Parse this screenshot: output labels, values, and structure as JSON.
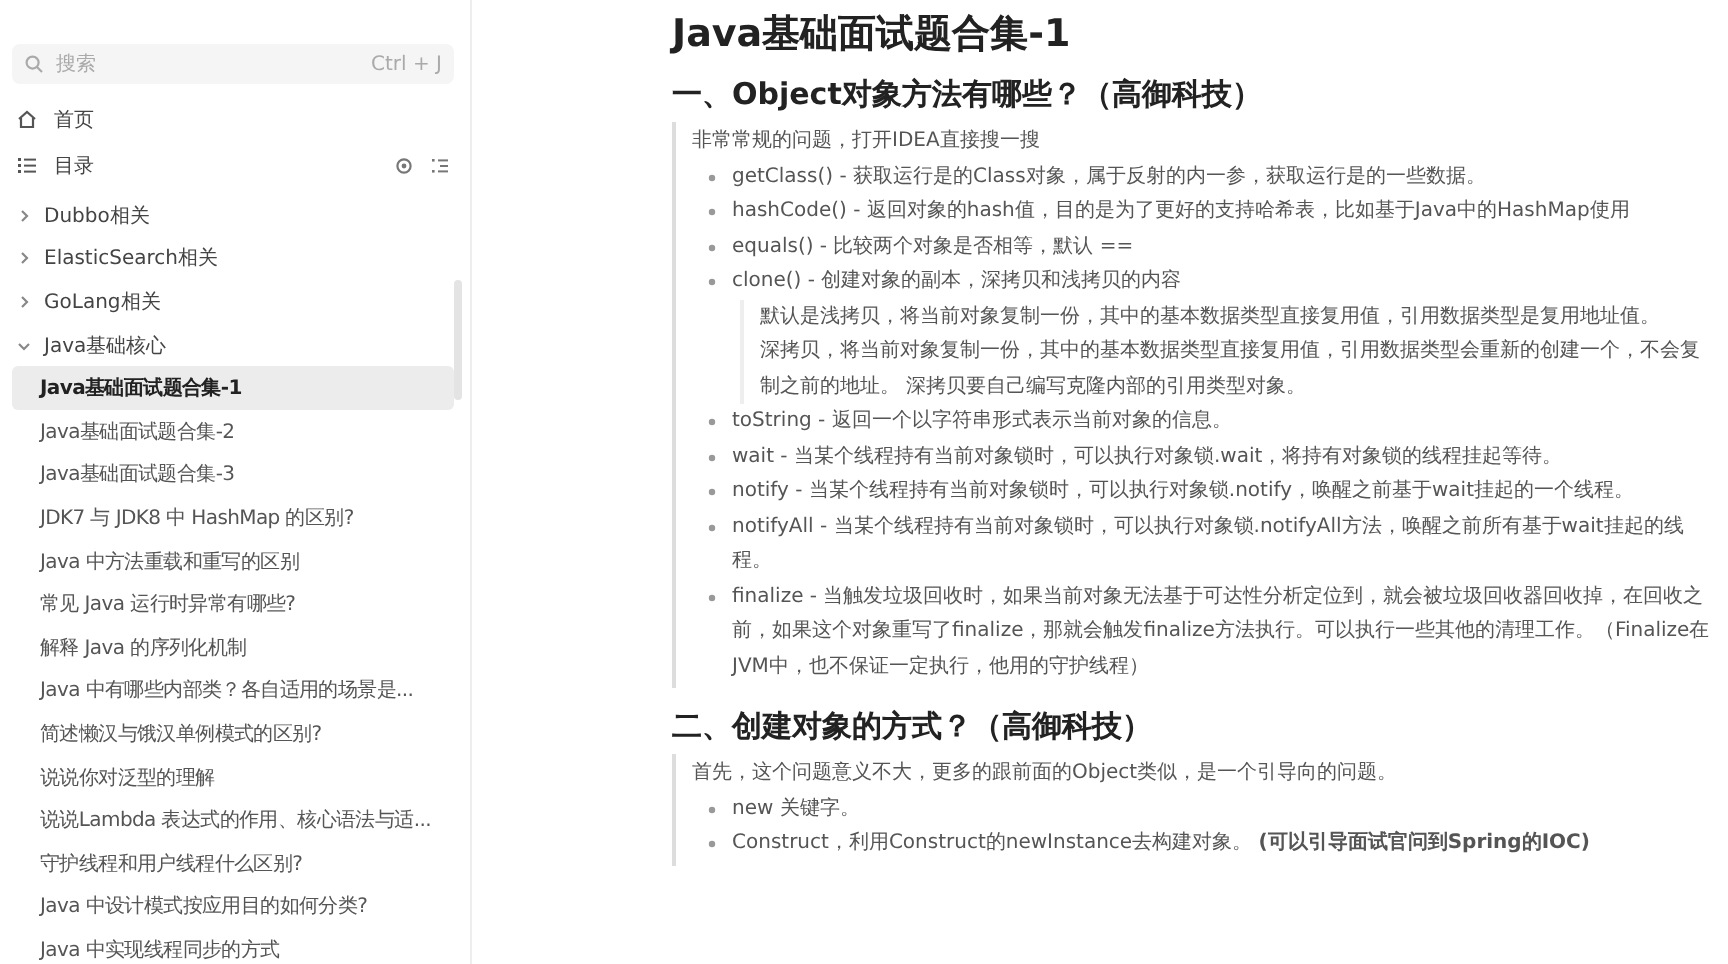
{
  "sidebar": {
    "search": {
      "placeholder": "搜索",
      "shortcut": "Ctrl + J"
    },
    "nav": [
      {
        "kind": "home",
        "label": "首页"
      },
      {
        "kind": "toc",
        "label": "目录"
      }
    ],
    "tree": [
      {
        "label": "Dubbo相关",
        "expanded": false
      },
      {
        "label": "ElasticSearch相关",
        "expanded": false
      },
      {
        "label": "GoLang相关",
        "expanded": false
      },
      {
        "label": "Java基础核心",
        "expanded": true,
        "children": [
          {
            "label": "Java基础面试题合集-1",
            "selected": true
          },
          {
            "label": "Java基础面试题合集-2",
            "selected": false
          },
          {
            "label": "Java基础面试题合集-3",
            "selected": false
          },
          {
            "label": "JDK7 与 JDK8 中 HashMap 的区别?",
            "selected": false
          },
          {
            "label": "Java 中方法重载和重写的区别",
            "selected": false
          },
          {
            "label": "常见 Java 运行时异常有哪些?",
            "selected": false
          },
          {
            "label": "解释 Java 的序列化机制",
            "selected": false
          },
          {
            "label": "Java 中有哪些内部类？各自适用的场景是...",
            "selected": false
          },
          {
            "label": "简述懒汉与饿汉单例模式的区别?",
            "selected": false
          },
          {
            "label": "说说你对泛型的理解",
            "selected": false
          },
          {
            "label": "说说Lambda 表达式的作用、核心语法与适...",
            "selected": false
          },
          {
            "label": "守护线程和用户线程什么区别?",
            "selected": false
          },
          {
            "label": "Java 中设计模式按应用目的如何分类?",
            "selected": false
          },
          {
            "label": "Java 中实现线程同步的方式",
            "selected": false
          }
        ]
      }
    ]
  },
  "document": {
    "title": "Java基础面试题合集-1",
    "sections": [
      {
        "heading": "一、Object对象方法有哪些？（高御科技）",
        "blocks": [
          {
            "kind": "paragraph",
            "text": "非常常规的问题，打开IDEA直接搜一搜"
          },
          {
            "kind": "bullet",
            "text": "getClass() - 获取运行是的Class对象，属于反射的内一参，获取运行是的一些数据。"
          },
          {
            "kind": "bullet",
            "text": "hashCode() - 返回对象的hash值，目的是为了更好的支持哈希表，比如基于Java中的HashMap使用"
          },
          {
            "kind": "bullet",
            "text": "equals() - 比较两个对象是否相等，默认 =="
          },
          {
            "kind": "bullet",
            "text": "clone() - 创建对象的副本，深拷贝和浅拷贝的内容",
            "notes": [
              "默认是浅拷贝，将当前对象复制一份，其中的基本数据类型直接复用值，引用数据类型是复用地址值。",
              "深拷贝，将当前对象复制一份，其中的基本数据类型直接复用值，引用数据类型会重新的创建一个，不会复制之前的地址。 深拷贝要自己编写克隆内部的引用类型对象。"
            ]
          },
          {
            "kind": "bullet",
            "text": "toString - 返回一个以字符串形式表示当前对象的信息。"
          },
          {
            "kind": "bullet",
            "text": "wait - 当某个线程持有当前对象锁时，可以执行对象锁.wait，将持有对象锁的线程挂起等待。"
          },
          {
            "kind": "bullet",
            "text": "notify - 当某个线程持有当前对象锁时，可以执行对象锁.notify，唤醒之前基于wait挂起的一个线程。"
          },
          {
            "kind": "bullet",
            "text": "notifyAll - 当某个线程持有当前对象锁时，可以执行对象锁.notifyAll方法，唤醒之前所有基于wait挂起的线程。"
          },
          {
            "kind": "bullet",
            "text": "finalize - 当触发垃圾回收时，如果当前对象无法基于可达性分析定位到，就会被垃圾回收器回收掉，在回收之前，如果这个对象重写了finalize，那就会触发finalize方法执行。可以执行一些其他的清理工作。（Finalize在JVM中，也不保证一定执行，他用的守护线程）"
          }
        ]
      },
      {
        "heading": "二、创建对象的方式？（高御科技）",
        "blocks": [
          {
            "kind": "paragraph",
            "text": "首先，这个问题意义不大，更多的跟前面的Object类似，是一个引导向的问题。"
          },
          {
            "kind": "bullet",
            "text": "new 关键字。"
          },
          {
            "kind": "bullet",
            "text": "Construct，利用Construct的newInstance去构建对象。 **(可以引导面试官问到Spring的IOC)**"
          }
        ]
      }
    ]
  }
}
